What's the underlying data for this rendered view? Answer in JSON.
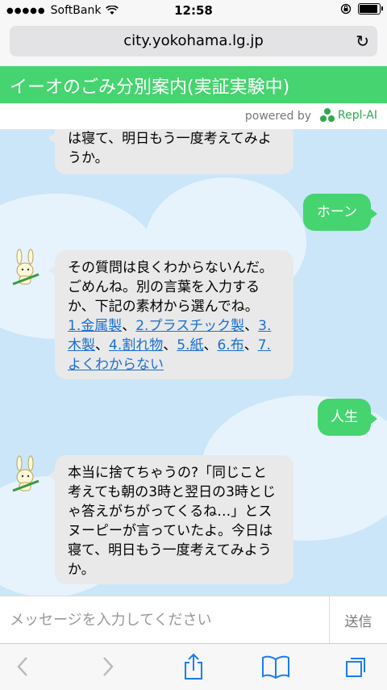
{
  "status_bar": {
    "carrier": "SoftBank",
    "time": "12:58"
  },
  "browser": {
    "url": "city.yokohama.lg.jp"
  },
  "app": {
    "title": "イーオのごみ分別案内(実証実験中)",
    "powered_by": "powered by",
    "brand": "Repl-AI",
    "accent": "#45d46f"
  },
  "messages": [
    {
      "from": "bot",
      "text": "は寝て、明日もう一度考えてみようか。"
    },
    {
      "from": "user",
      "text": "ホーン"
    },
    {
      "from": "bot",
      "intro": "その質問は良くわからないんだ。ごめんね。別の言葉を入力するか、下記の素材から選んでね。",
      "links": [
        "1.金属製",
        "2.プラスチック製",
        "3.木製",
        "4.割れ物",
        "5.紙",
        "6.布",
        "7.よくわからない"
      ],
      "separator": "、"
    },
    {
      "from": "user",
      "text": "人生"
    },
    {
      "from": "bot",
      "text": "本当に捨てちゃうの?「同じこと考えても朝の3時と翌日の3時とじゃ答えがちがってくるね…」とスヌーピーが言っていたよ。今日は寝て、明日もう一度考えてみようか。"
    }
  ],
  "composer": {
    "placeholder": "メッセージを入力してください",
    "send_label": "送信"
  },
  "toolbar": {
    "icons": [
      "back-icon",
      "forward-icon",
      "share-icon",
      "bookmarks-icon",
      "tabs-icon"
    ]
  }
}
